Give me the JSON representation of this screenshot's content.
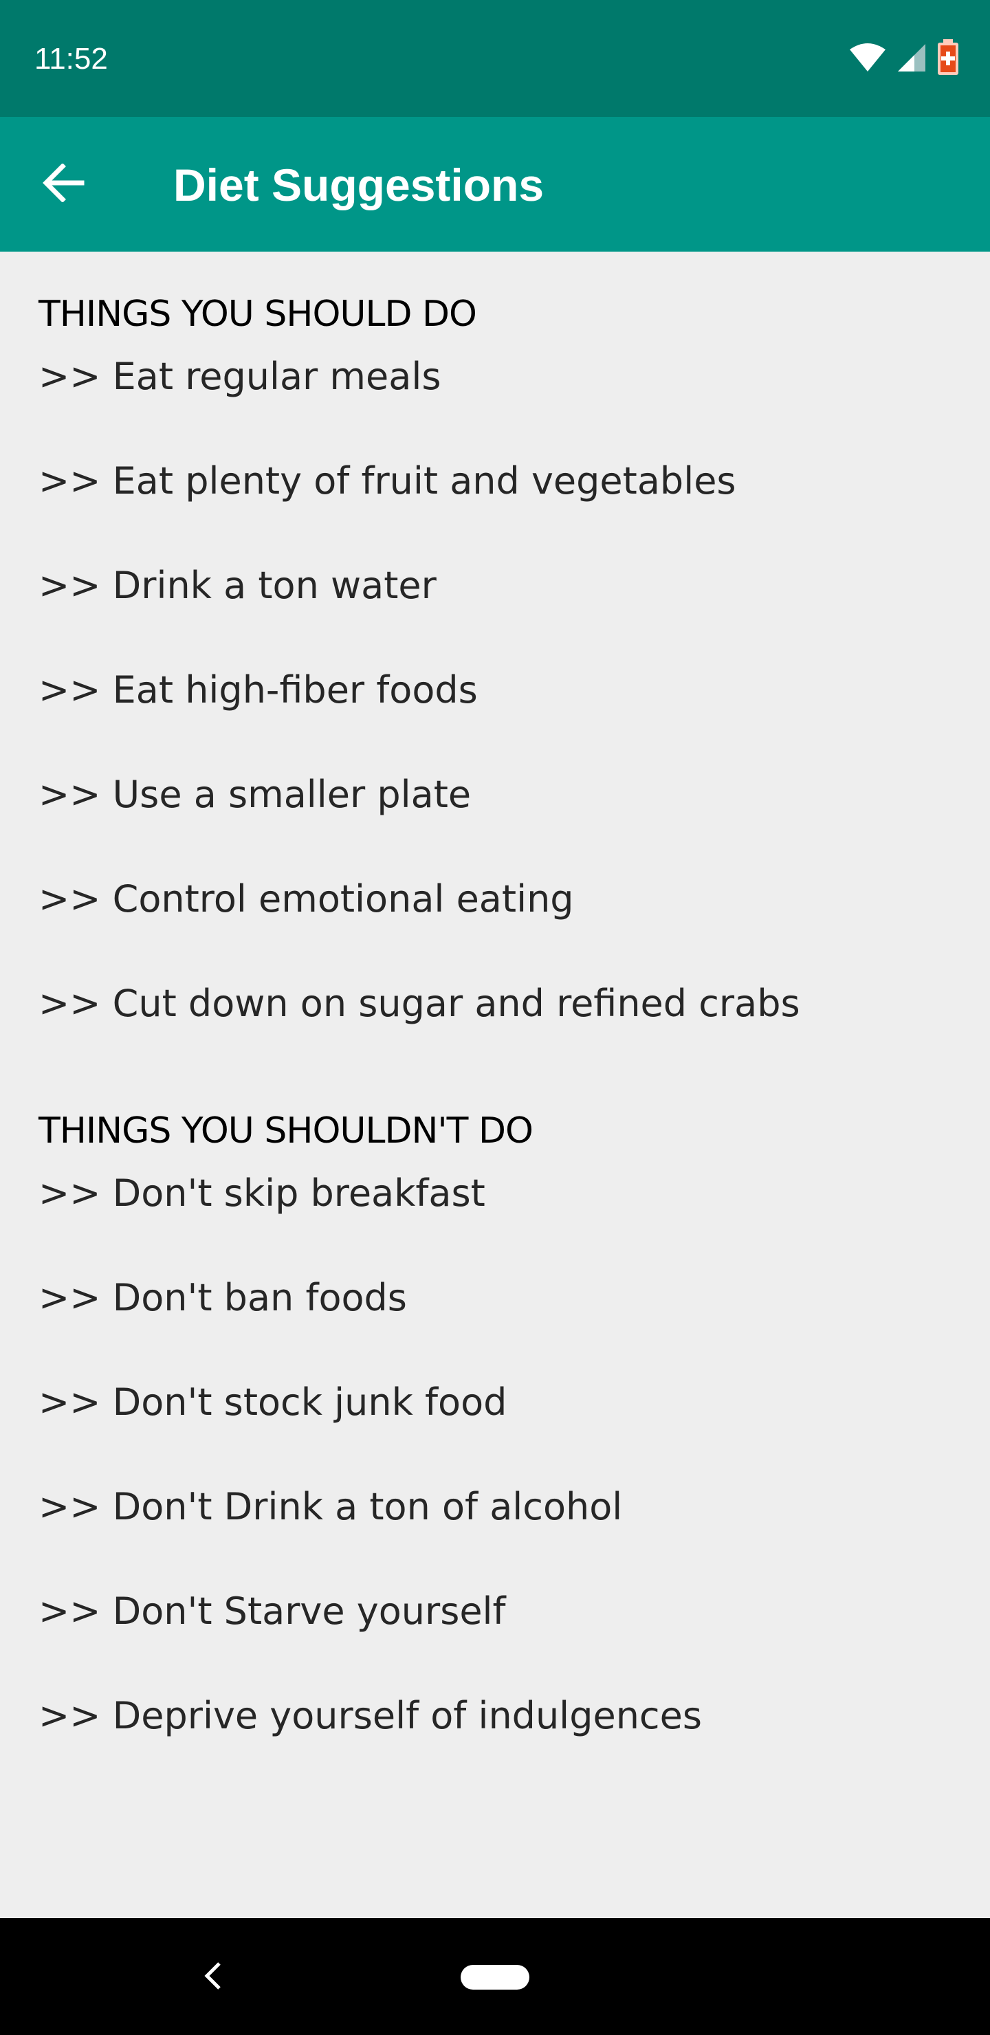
{
  "status_bar": {
    "time": "11:52",
    "icons": [
      "wifi-icon",
      "cell-signal-icon",
      "battery-charging-icon"
    ]
  },
  "app_bar": {
    "title": "Diet Suggestions",
    "back_icon": "arrow-back-icon",
    "color": "#009688"
  },
  "sections": [
    {
      "heading": "THINGS YOU SHOULD DO",
      "items": [
        ">> Eat regular meals",
        ">> Eat plenty of fruit and vegetables",
        ">> Drink a ton water",
        ">> Eat high-fiber foods",
        ">> Use a smaller plate",
        ">> Control emotional eating",
        ">> Cut down on sugar and refined crabs"
      ]
    },
    {
      "heading": "THINGS YOU SHOULDN'T DO",
      "items": [
        ">> Don't skip breakfast",
        ">> Don't ban foods",
        ">> Don't stock junk food",
        ">> Don't Drink a ton of alcohol",
        ">> Don't Starve yourself",
        ">> Deprive yourself of indulgences"
      ]
    }
  ],
  "nav_bar": {
    "back_icon": "nav-back-icon",
    "home_icon": "nav-home-pill-icon"
  }
}
